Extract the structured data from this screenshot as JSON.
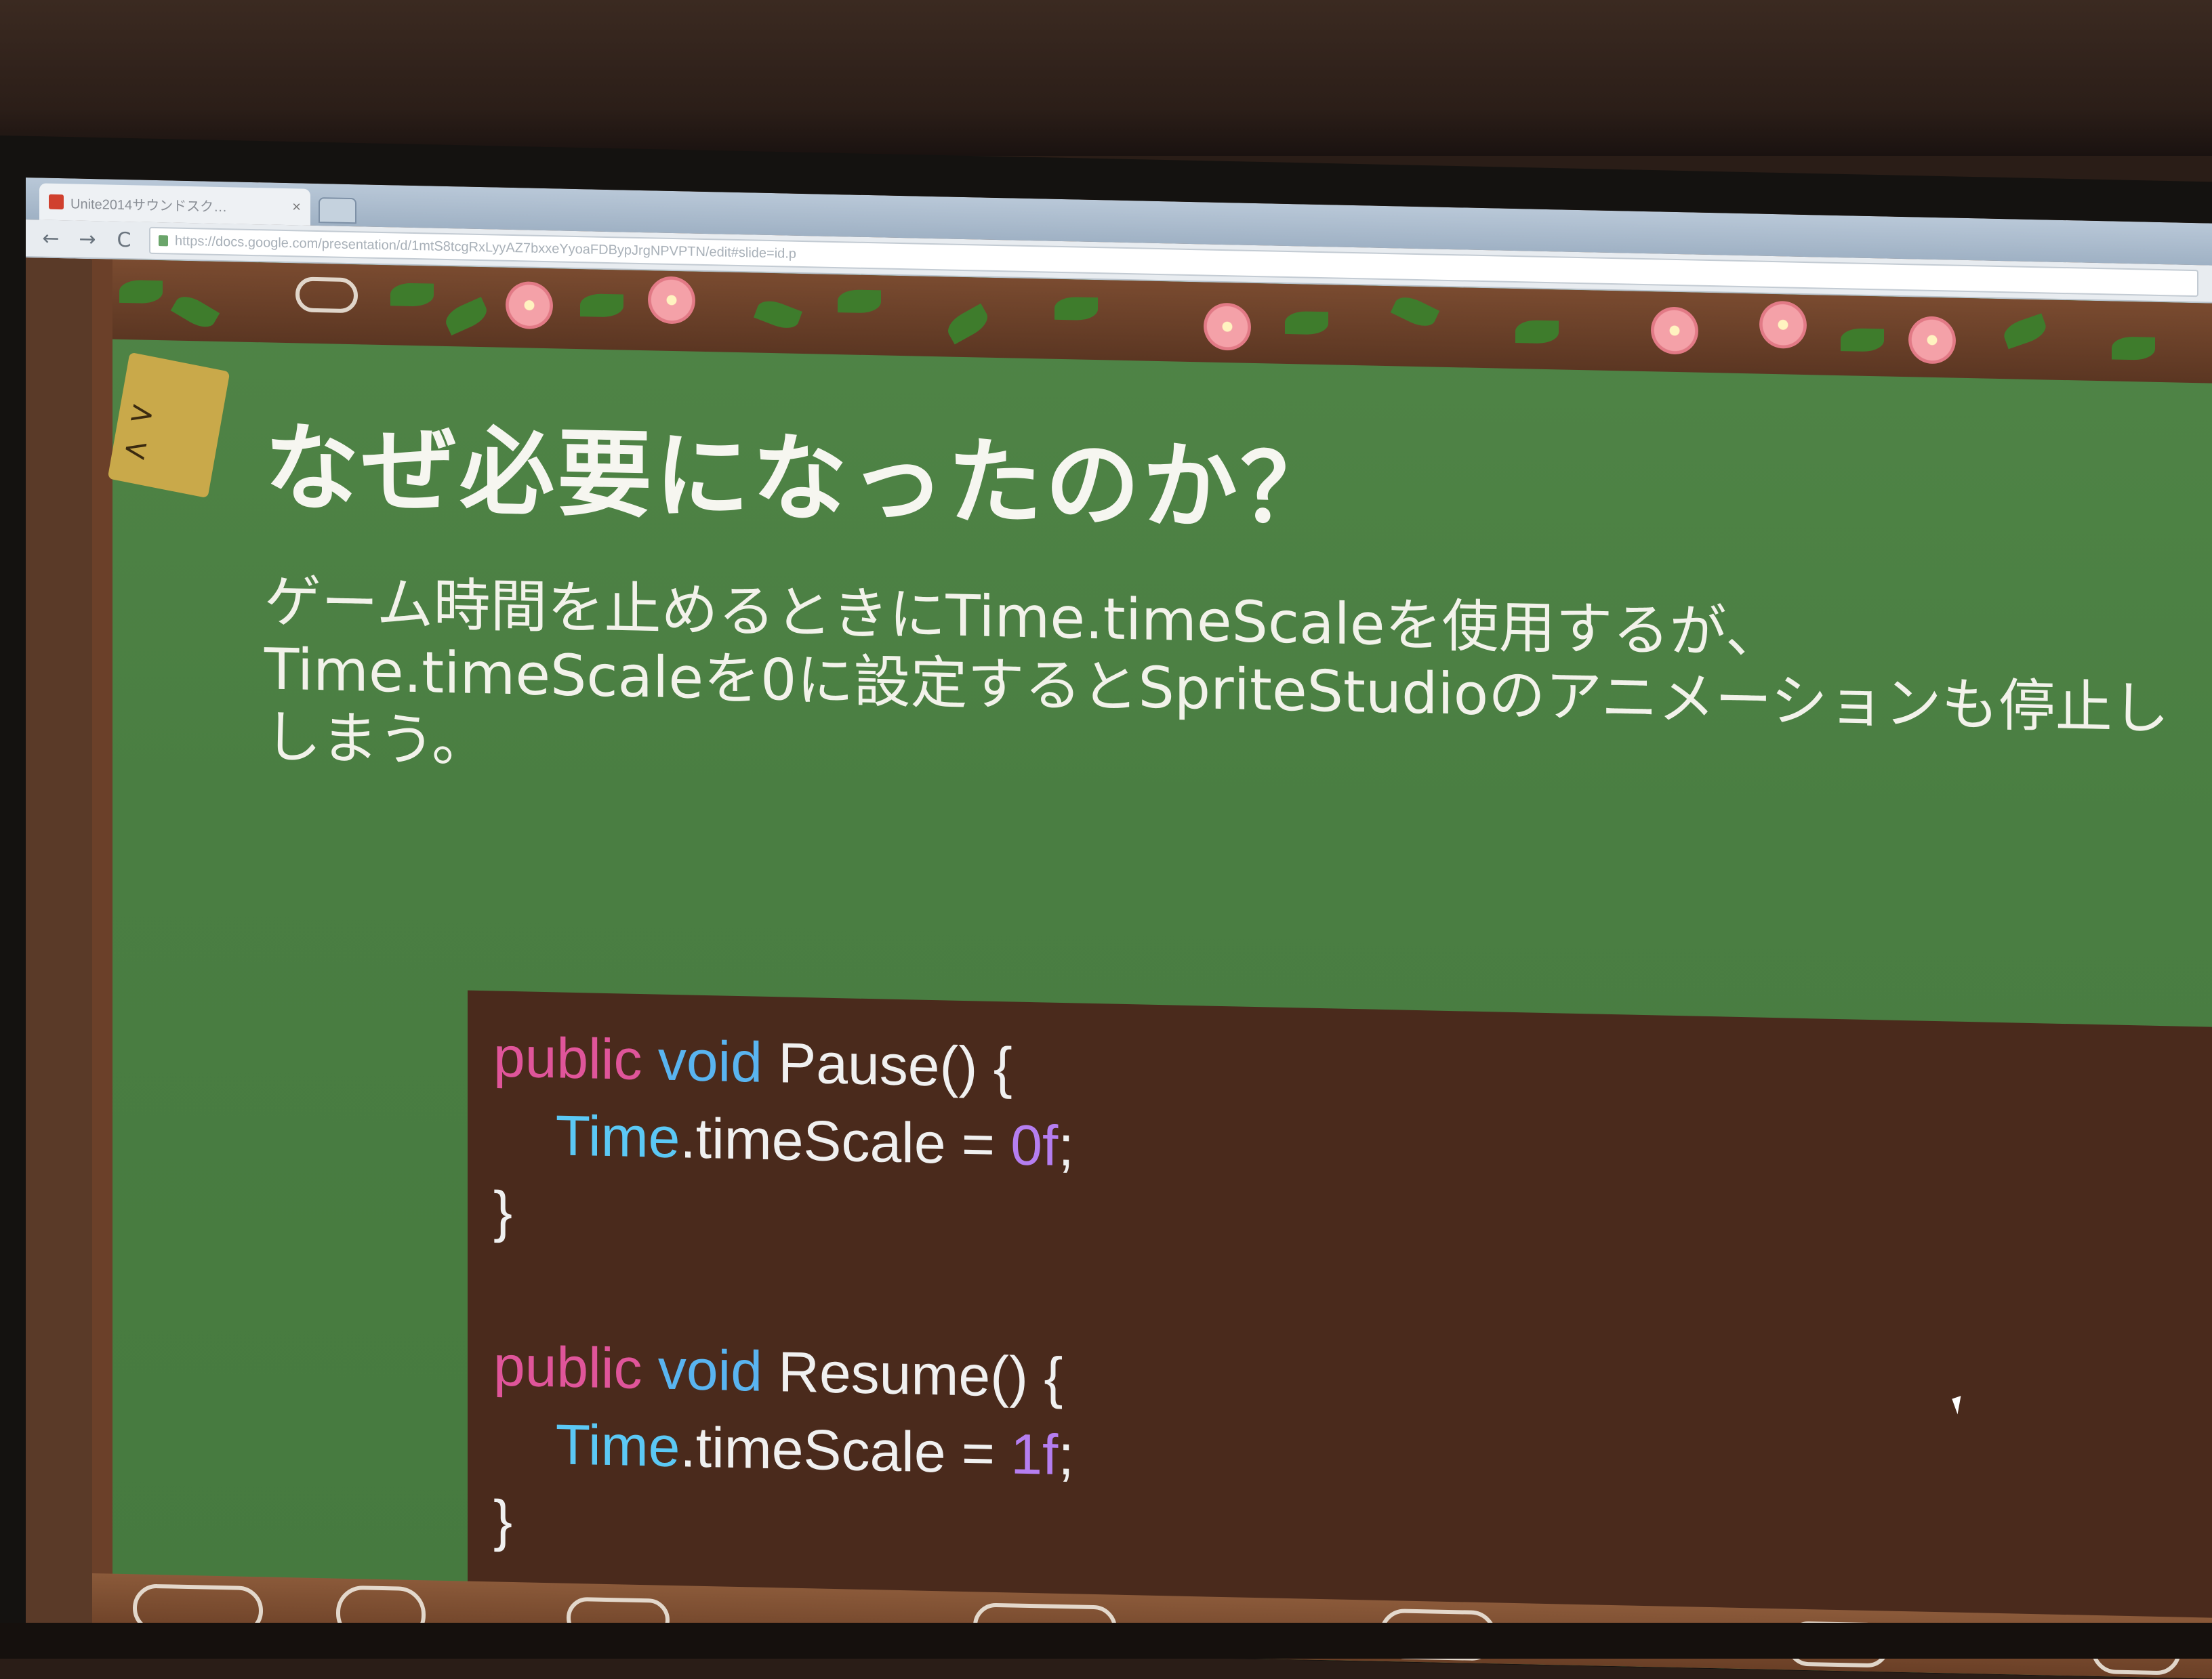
{
  "browser": {
    "tab_title": "Unite2014サウンドスク…",
    "tab_close": "×",
    "url": "https://docs.google.com/presentation/d/1mtS8tcgRxLyyAZ7bxxeYyoaFDBypJrgNPVPTN/edit#slide=id.p",
    "nav": {
      "back": "←",
      "forward": "→",
      "reload": "C"
    }
  },
  "slide": {
    "title": "なぜ必要になったのか？",
    "body_lines": [
      "ゲーム時間を止めるときにTime.timeScaleを使用するが、",
      "Time.timeScaleを0に設定するとSpriteStudioのアニメーションも停止し",
      "しまう。"
    ],
    "mascot_face": "> <",
    "code": {
      "pause_signature": {
        "kw1": "public",
        "kw2": "void",
        "rest": "Pause() {"
      },
      "pause_body": {
        "obj": "Time",
        "rest": ".timeScale = ",
        "num": "0f",
        "end": ";"
      },
      "close1": "}",
      "resume_signature": {
        "kw1": "public",
        "kw2": "void",
        "rest": "Resume() {"
      },
      "resume_body": {
        "obj": "Time",
        "rest": ".timeScale = ",
        "num": "1f",
        "end": ";"
      },
      "close2": "}"
    }
  },
  "colors": {
    "chalkboard": "#4f8446",
    "code_background": "#4a2a1c",
    "keyword_public": "#e0559a",
    "keyword_void": "#59b4f0",
    "number": "#b57ef0"
  }
}
